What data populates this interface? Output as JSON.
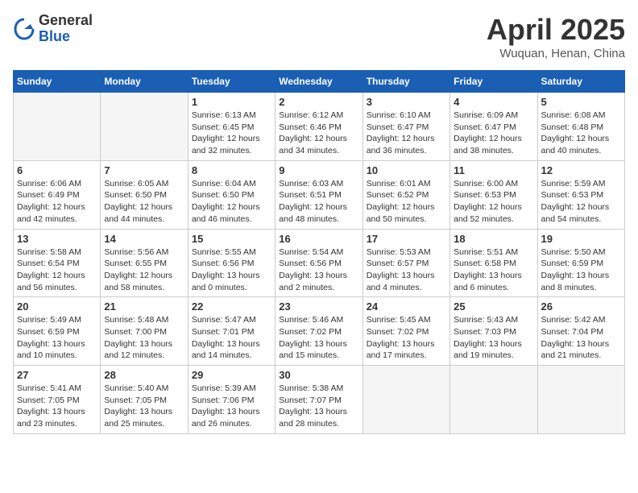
{
  "header": {
    "logo": {
      "general": "General",
      "blue": "Blue"
    },
    "title": "April 2025",
    "location": "Wuquan, Henan, China"
  },
  "calendar": {
    "days_of_week": [
      "Sunday",
      "Monday",
      "Tuesday",
      "Wednesday",
      "Thursday",
      "Friday",
      "Saturday"
    ],
    "weeks": [
      [
        {
          "day": "",
          "info": ""
        },
        {
          "day": "",
          "info": ""
        },
        {
          "day": "1",
          "info": "Sunrise: 6:13 AM\nSunset: 6:45 PM\nDaylight: 12 hours\nand 32 minutes."
        },
        {
          "day": "2",
          "info": "Sunrise: 6:12 AM\nSunset: 6:46 PM\nDaylight: 12 hours\nand 34 minutes."
        },
        {
          "day": "3",
          "info": "Sunrise: 6:10 AM\nSunset: 6:47 PM\nDaylight: 12 hours\nand 36 minutes."
        },
        {
          "day": "4",
          "info": "Sunrise: 6:09 AM\nSunset: 6:47 PM\nDaylight: 12 hours\nand 38 minutes."
        },
        {
          "day": "5",
          "info": "Sunrise: 6:08 AM\nSunset: 6:48 PM\nDaylight: 12 hours\nand 40 minutes."
        }
      ],
      [
        {
          "day": "6",
          "info": "Sunrise: 6:06 AM\nSunset: 6:49 PM\nDaylight: 12 hours\nand 42 minutes."
        },
        {
          "day": "7",
          "info": "Sunrise: 6:05 AM\nSunset: 6:50 PM\nDaylight: 12 hours\nand 44 minutes."
        },
        {
          "day": "8",
          "info": "Sunrise: 6:04 AM\nSunset: 6:50 PM\nDaylight: 12 hours\nand 46 minutes."
        },
        {
          "day": "9",
          "info": "Sunrise: 6:03 AM\nSunset: 6:51 PM\nDaylight: 12 hours\nand 48 minutes."
        },
        {
          "day": "10",
          "info": "Sunrise: 6:01 AM\nSunset: 6:52 PM\nDaylight: 12 hours\nand 50 minutes."
        },
        {
          "day": "11",
          "info": "Sunrise: 6:00 AM\nSunset: 6:53 PM\nDaylight: 12 hours\nand 52 minutes."
        },
        {
          "day": "12",
          "info": "Sunrise: 5:59 AM\nSunset: 6:53 PM\nDaylight: 12 hours\nand 54 minutes."
        }
      ],
      [
        {
          "day": "13",
          "info": "Sunrise: 5:58 AM\nSunset: 6:54 PM\nDaylight: 12 hours\nand 56 minutes."
        },
        {
          "day": "14",
          "info": "Sunrise: 5:56 AM\nSunset: 6:55 PM\nDaylight: 12 hours\nand 58 minutes."
        },
        {
          "day": "15",
          "info": "Sunrise: 5:55 AM\nSunset: 6:56 PM\nDaylight: 13 hours\nand 0 minutes."
        },
        {
          "day": "16",
          "info": "Sunrise: 5:54 AM\nSunset: 6:56 PM\nDaylight: 13 hours\nand 2 minutes."
        },
        {
          "day": "17",
          "info": "Sunrise: 5:53 AM\nSunset: 6:57 PM\nDaylight: 13 hours\nand 4 minutes."
        },
        {
          "day": "18",
          "info": "Sunrise: 5:51 AM\nSunset: 6:58 PM\nDaylight: 13 hours\nand 6 minutes."
        },
        {
          "day": "19",
          "info": "Sunrise: 5:50 AM\nSunset: 6:59 PM\nDaylight: 13 hours\nand 8 minutes."
        }
      ],
      [
        {
          "day": "20",
          "info": "Sunrise: 5:49 AM\nSunset: 6:59 PM\nDaylight: 13 hours\nand 10 minutes."
        },
        {
          "day": "21",
          "info": "Sunrise: 5:48 AM\nSunset: 7:00 PM\nDaylight: 13 hours\nand 12 minutes."
        },
        {
          "day": "22",
          "info": "Sunrise: 5:47 AM\nSunset: 7:01 PM\nDaylight: 13 hours\nand 14 minutes."
        },
        {
          "day": "23",
          "info": "Sunrise: 5:46 AM\nSunset: 7:02 PM\nDaylight: 13 hours\nand 15 minutes."
        },
        {
          "day": "24",
          "info": "Sunrise: 5:45 AM\nSunset: 7:02 PM\nDaylight: 13 hours\nand 17 minutes."
        },
        {
          "day": "25",
          "info": "Sunrise: 5:43 AM\nSunset: 7:03 PM\nDaylight: 13 hours\nand 19 minutes."
        },
        {
          "day": "26",
          "info": "Sunrise: 5:42 AM\nSunset: 7:04 PM\nDaylight: 13 hours\nand 21 minutes."
        }
      ],
      [
        {
          "day": "27",
          "info": "Sunrise: 5:41 AM\nSunset: 7:05 PM\nDaylight: 13 hours\nand 23 minutes."
        },
        {
          "day": "28",
          "info": "Sunrise: 5:40 AM\nSunset: 7:05 PM\nDaylight: 13 hours\nand 25 minutes."
        },
        {
          "day": "29",
          "info": "Sunrise: 5:39 AM\nSunset: 7:06 PM\nDaylight: 13 hours\nand 26 minutes."
        },
        {
          "day": "30",
          "info": "Sunrise: 5:38 AM\nSunset: 7:07 PM\nDaylight: 13 hours\nand 28 minutes."
        },
        {
          "day": "",
          "info": ""
        },
        {
          "day": "",
          "info": ""
        },
        {
          "day": "",
          "info": ""
        }
      ]
    ]
  }
}
